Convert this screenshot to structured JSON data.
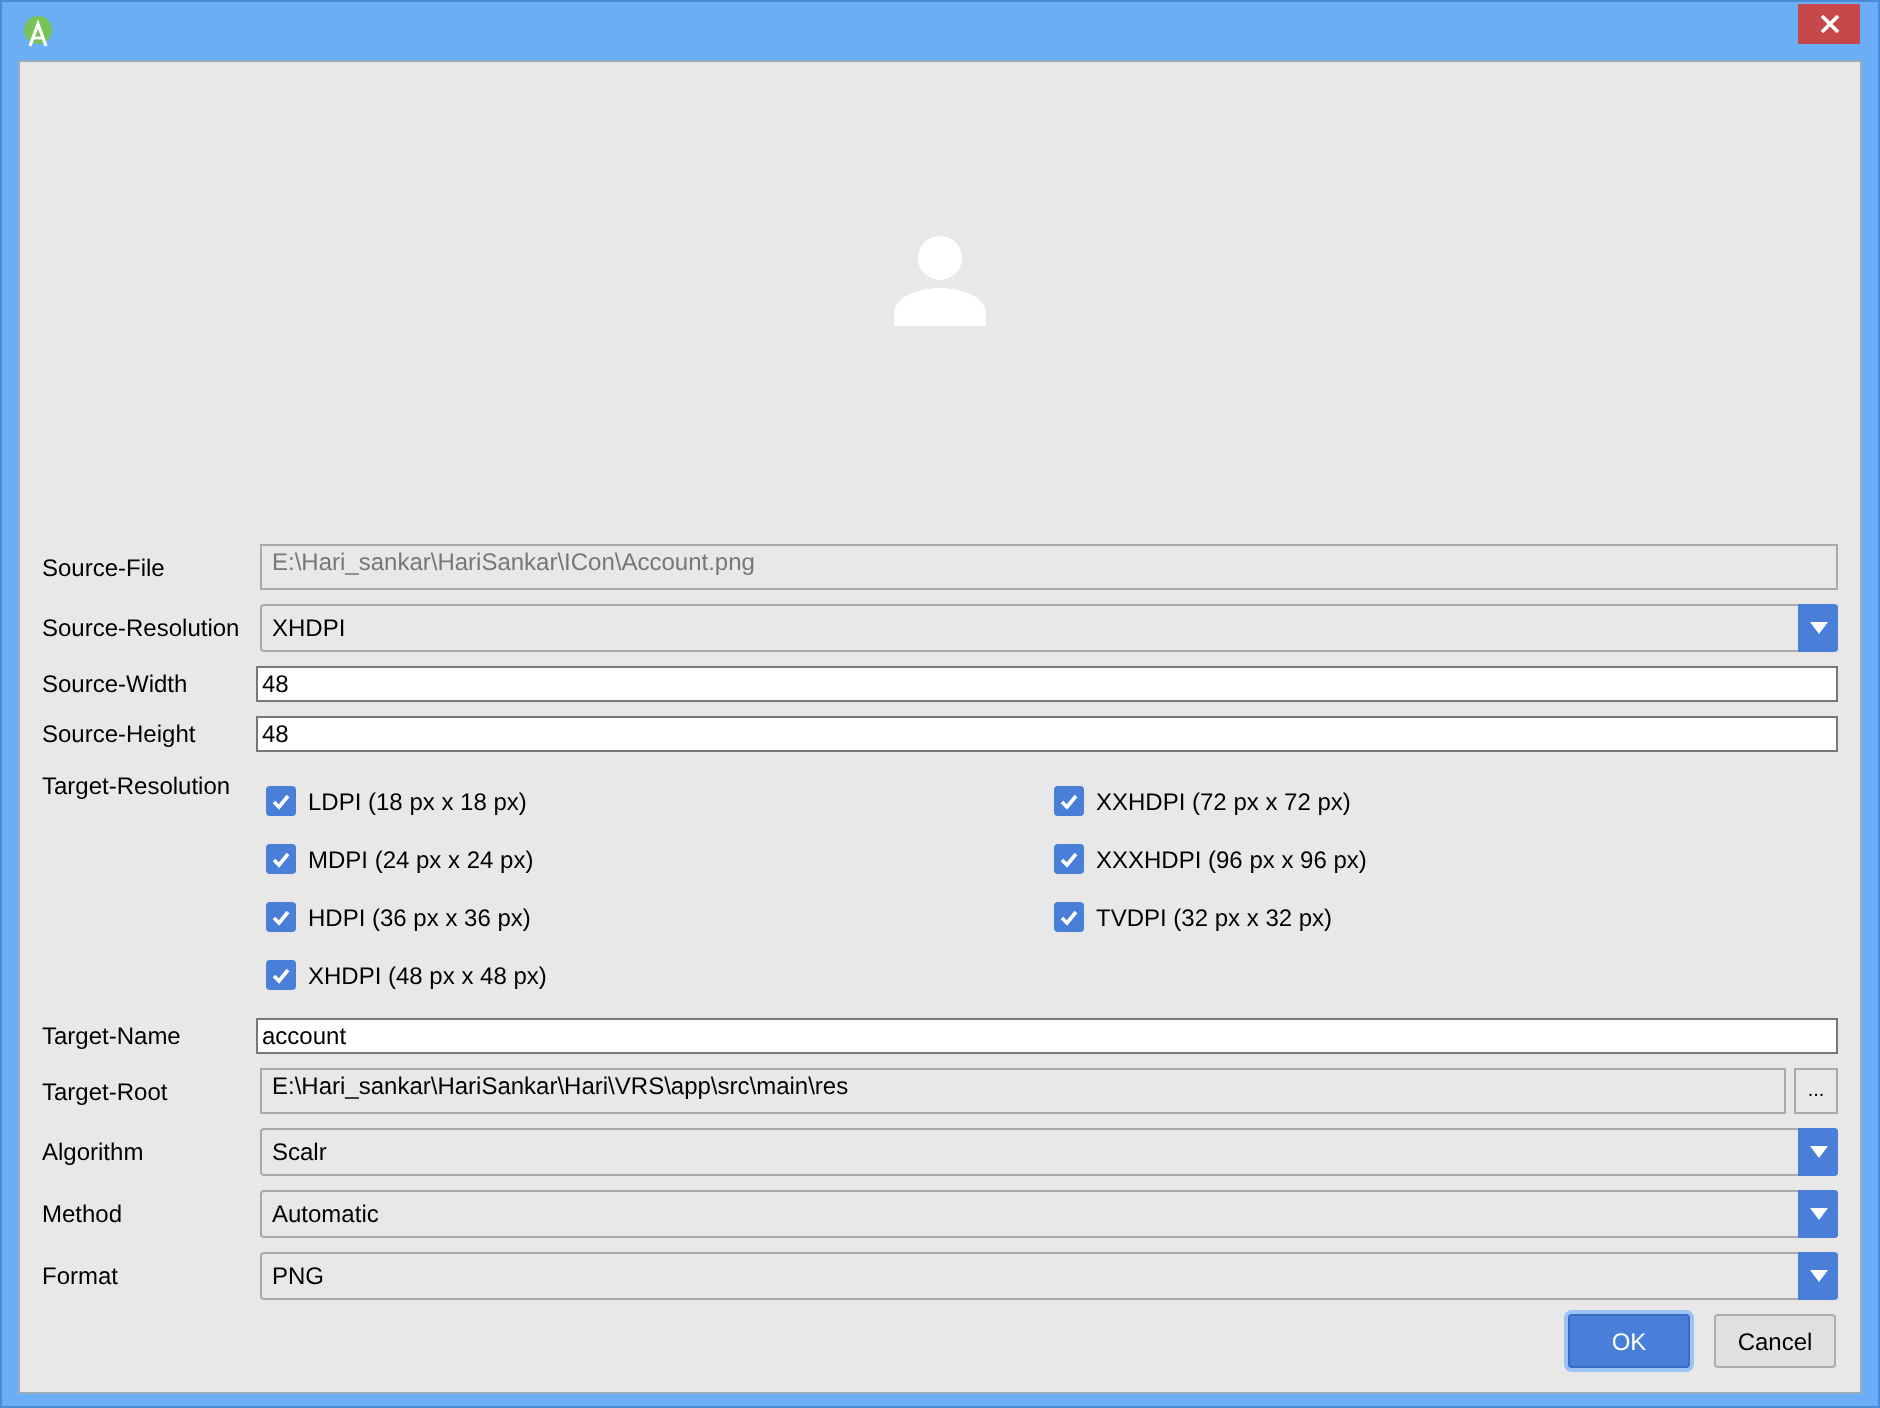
{
  "fields": [
    {
      "kind": "readonly",
      "label": "Source-File",
      "value": "E:\\Hari_sankar\\HariSankar\\ICon\\Account.png"
    },
    {
      "kind": "select",
      "label": "Source-Resolution",
      "value": "XHDPI"
    },
    {
      "kind": "input",
      "label": "Source-Width",
      "value": "48"
    },
    {
      "kind": "input",
      "label": "Source-Height",
      "value": "48"
    },
    {
      "kind": "checks",
      "label": "Target-Resolution",
      "options": [
        {
          "label": "LDPI (18 px x 18 px)",
          "checked": true
        },
        {
          "label": "MDPI (24 px x 24 px)",
          "checked": true
        },
        {
          "label": "HDPI (36 px x 36 px)",
          "checked": true
        },
        {
          "label": "XHDPI (48 px x 48 px)",
          "checked": true
        },
        {
          "label": "XXHDPI (72 px x 72 px)",
          "checked": true
        },
        {
          "label": "XXXHDPI (96 px x 96 px)",
          "checked": true
        },
        {
          "label": "TVDPI (32 px x 32 px)",
          "checked": true
        }
      ]
    },
    {
      "kind": "input",
      "label": "Target-Name",
      "value": "account"
    },
    {
      "kind": "path",
      "label": "Target-Root",
      "value": "E:\\Hari_sankar\\HariSankar\\Hari\\VRS\\app\\src\\main\\res",
      "browse": "..."
    },
    {
      "kind": "combo",
      "label": "Algorithm",
      "value": "Scalr"
    },
    {
      "kind": "combo",
      "label": "Method",
      "value": "Automatic"
    },
    {
      "kind": "combo",
      "label": "Format",
      "value": "PNG"
    }
  ],
  "buttons": [
    {
      "label": "OK",
      "default": true
    },
    {
      "label": "Cancel",
      "default": false
    }
  ]
}
